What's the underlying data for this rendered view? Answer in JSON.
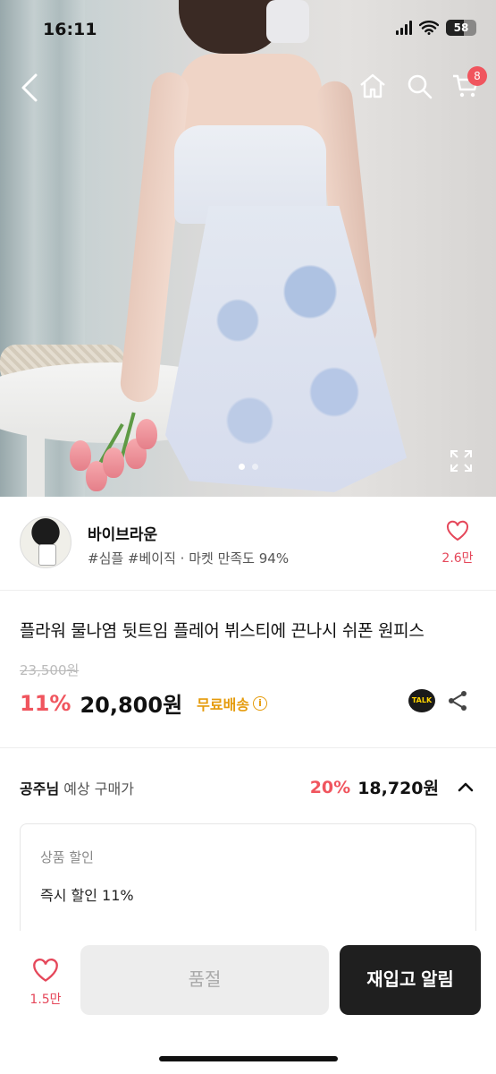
{
  "status_bar": {
    "time": "16:11",
    "battery": "58"
  },
  "nav": {
    "cart_count": "8",
    "icons": [
      "back-icon",
      "home-icon",
      "search-icon",
      "cart-icon"
    ]
  },
  "gallery": {
    "image_alt": "woman in light blue floral chiffon slip dress holding pink tulips",
    "current_index": 1,
    "total": 2
  },
  "seller": {
    "name": "바이브라운",
    "tags": "#심플 #베이직 · 마켓 만족도 94%",
    "likes": "2.6만"
  },
  "product": {
    "title": "플라워 물나염 뒷트임 플레어 뷔스티에 끈나시 쉬폰 원피스",
    "original_price": "23,500원",
    "discount": "11%",
    "price": "20,800원",
    "shipping": "무료배송",
    "talk_label": "TALK"
  },
  "expected": {
    "user": "공주님",
    "label": "예상 구매가",
    "discount": "20%",
    "price": "18,720원"
  },
  "discount_detail": {
    "heading": "상품 할인",
    "item": "즉시 할인 11%"
  },
  "bottom": {
    "likes": "1.5만",
    "soldout_label": "품절",
    "restock_label": "재입고 알림"
  },
  "colors": {
    "accent_pink": "#f0555e",
    "shipping_yellow": "#e59b0b",
    "dark_button": "#1f1f1f"
  }
}
